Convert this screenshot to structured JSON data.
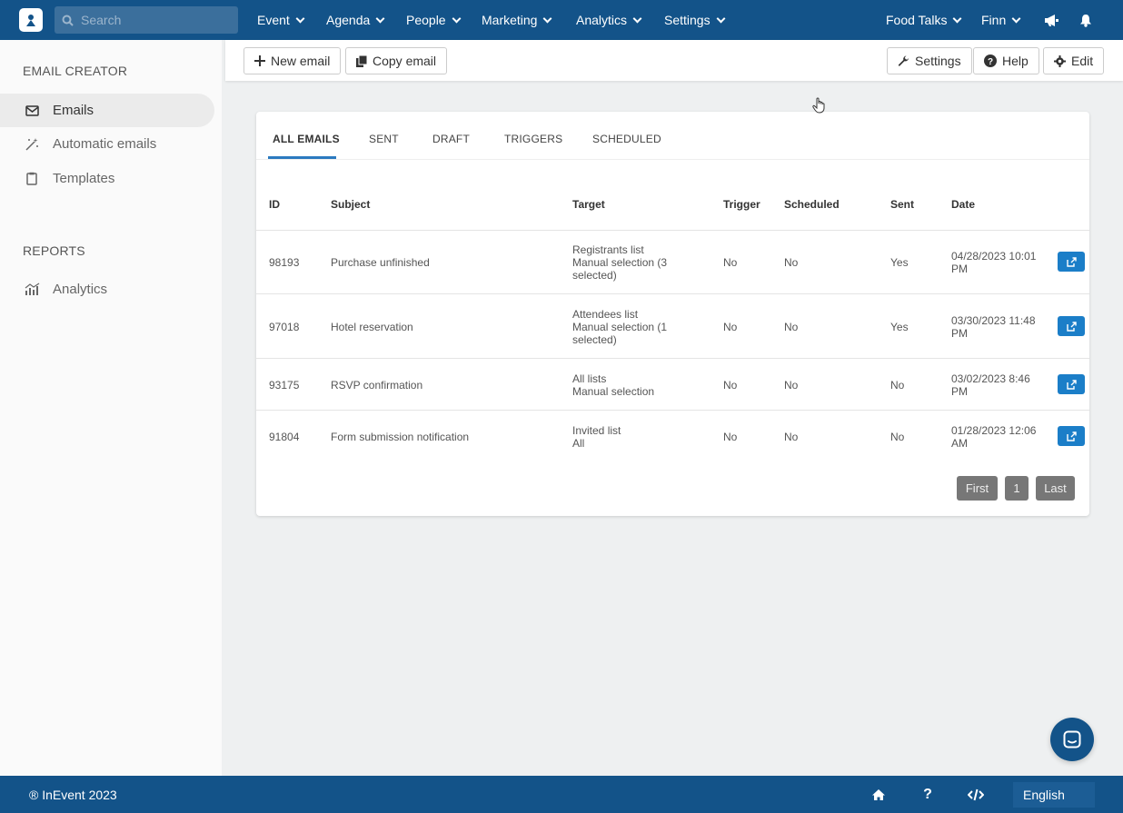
{
  "topbar": {
    "search_placeholder": "Search",
    "nav": [
      "Event",
      "Agenda",
      "People",
      "Marketing",
      "Analytics",
      "Settings"
    ],
    "event_name": "Food Talks",
    "user_name": "Finn"
  },
  "sidebar": {
    "heading_email": "EMAIL CREATOR",
    "heading_reports": "REPORTS",
    "items": {
      "emails": "Emails",
      "automatic": "Automatic emails",
      "templates": "Templates",
      "analytics": "Analytics"
    }
  },
  "toolbar": {
    "new_email": "New email",
    "copy_email": "Copy email",
    "settings": "Settings",
    "help": "Help",
    "edit": "Edit"
  },
  "tabs": [
    "ALL EMAILS",
    "SENT",
    "DRAFT",
    "TRIGGERS",
    "SCHEDULED"
  ],
  "table": {
    "headers": [
      "ID",
      "Subject",
      "Target",
      "Trigger",
      "Scheduled",
      "Sent",
      "Date"
    ],
    "rows": [
      {
        "id": "98193",
        "subject": "Purchase unfinished",
        "target1": "Registrants list",
        "target2": "Manual selection (3",
        "target3": "selected)",
        "trigger": "No",
        "scheduled": "No",
        "sent": "Yes",
        "date1": "04/28/2023 10:01",
        "date2": "PM"
      },
      {
        "id": "97018",
        "subject": "Hotel reservation",
        "target1": "Attendees list",
        "target2": "Manual selection (1",
        "target3": "selected)",
        "trigger": "No",
        "scheduled": "No",
        "sent": "Yes",
        "date1": "03/30/2023 11:48",
        "date2": "PM"
      },
      {
        "id": "93175",
        "subject": "RSVP confirmation",
        "target1": "All lists",
        "target2": "Manual selection",
        "target3": "",
        "trigger": "No",
        "scheduled": "No",
        "sent": "No",
        "date1": "03/02/2023 8:46",
        "date2": "PM"
      },
      {
        "id": "91804",
        "subject": "Form submission notification",
        "target1": "Invited list",
        "target2": "All",
        "target3": "",
        "trigger": "No",
        "scheduled": "No",
        "sent": "No",
        "date1": "01/28/2023 12:06",
        "date2": "AM"
      }
    ]
  },
  "pager": {
    "first": "First",
    "page": "1",
    "last": "Last"
  },
  "footer": {
    "copyright": "® InEvent 2023",
    "help_glyph": "?",
    "language": "English"
  },
  "colors": {
    "brand": "#135389",
    "accent": "#2b7ac0",
    "action": "#1b7ec8"
  }
}
